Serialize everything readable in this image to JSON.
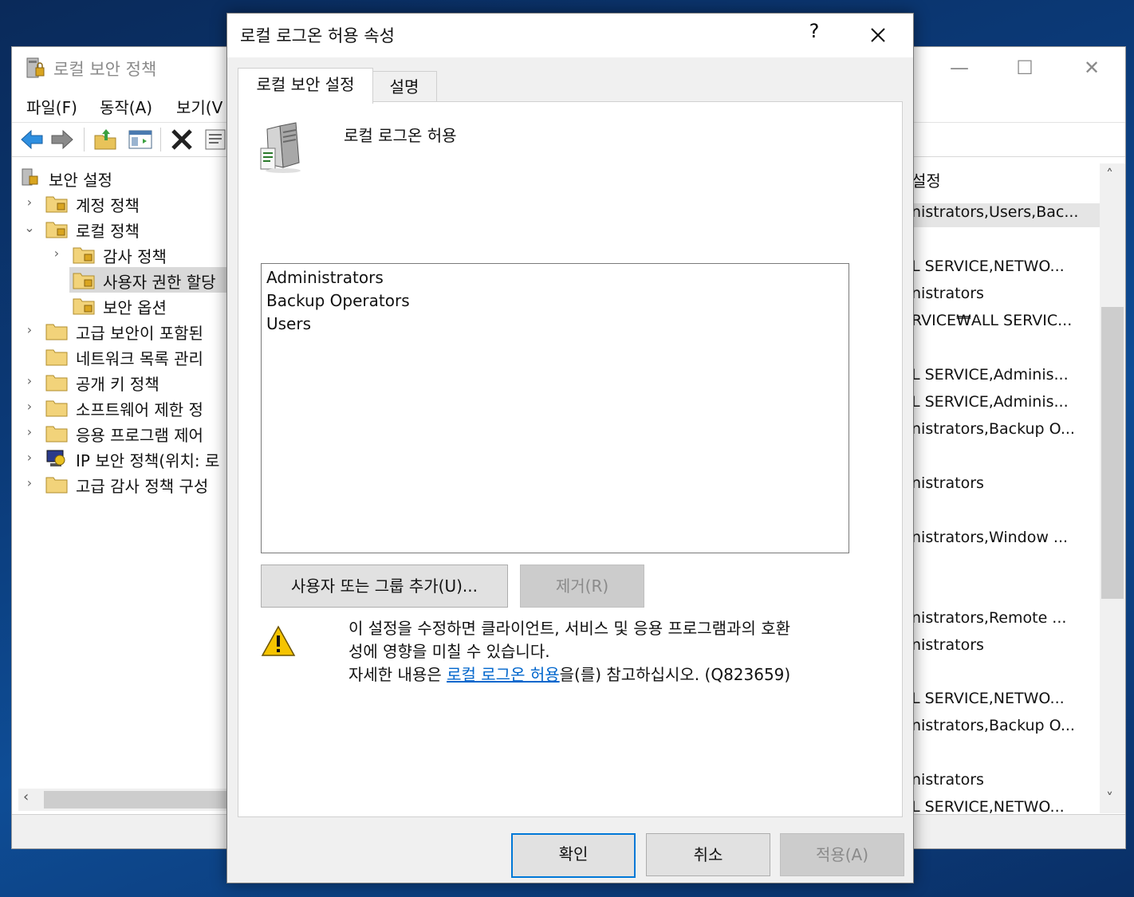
{
  "mmc": {
    "title": "로컬 보안 정책",
    "menu": [
      "파일(F)",
      "동작(A)",
      "보기(V"
    ],
    "tree": [
      {
        "label": "보안 설정",
        "chevron": "",
        "level": 0
      },
      {
        "label": "계정 정책",
        "chevron": "›",
        "level": 1
      },
      {
        "label": "로컬 정책",
        "chevron": "⌄",
        "level": 1
      },
      {
        "label": "감사 정책",
        "chevron": "›",
        "level": 2
      },
      {
        "label": "사용자 권한 할당",
        "chevron": "",
        "level": 2
      },
      {
        "label": "보안 옵션",
        "chevron": "",
        "level": 2
      },
      {
        "label": "고급 보안이 포함된",
        "chevron": "›",
        "level": 1
      },
      {
        "label": "네트워크 목록 관리",
        "chevron": "",
        "level": 1
      },
      {
        "label": "공개 키 정책",
        "chevron": "›",
        "level": 1
      },
      {
        "label": "소프트웨어 제한 정",
        "chevron": "›",
        "level": 1
      },
      {
        "label": "응용 프로그램 제어",
        "chevron": "›",
        "level": 1
      },
      {
        "label": "IP 보안 정책(위치: 로",
        "chevron": "›",
        "level": 1
      },
      {
        "label": "고급 감사 정책 구성",
        "chevron": "›",
        "level": 1
      }
    ],
    "right_header": "설정",
    "right_items": [
      "nistrators,Users,Bac...",
      "L SERVICE,NETWO...",
      "nistrators",
      "RVICE₩ALL SERVIC...",
      "L SERVICE,Adminis...",
      "L SERVICE,Adminis...",
      "nistrators,Backup O...",
      "nistrators",
      "nistrators,Window ...",
      "nistrators,Remote ...",
      "nistrators",
      "L SERVICE,NETWO...",
      "nistrators,Backup O...",
      "nistrators",
      "L SERVICE,NETWO..."
    ]
  },
  "dialog": {
    "title": "로컬 로그온 허용 속성",
    "help": "?",
    "tabs": [
      "로컬 보안 설정",
      "설명"
    ],
    "policy_name": "로컬 로그온 허용",
    "members": [
      "Administrators",
      "Backup Operators",
      "Users"
    ],
    "add_button": "사용자 또는 그룹 추가(U)...",
    "remove_button": "제거(R)",
    "warning_line1": "이 설정을 수정하면 클라이언트, 서비스 및 응용 프로그램과의 호환",
    "warning_line2": "성에 영향을 미칠 수 있습니다.",
    "warning_line3_pre": "자세한 내용은 ",
    "warning_link": "로컬 로그온 허용",
    "warning_line3_post": "을(를) 참고하십시오. (Q823659)",
    "ok_button": "확인",
    "cancel_button": "취소",
    "apply_button": "적용(A)"
  }
}
